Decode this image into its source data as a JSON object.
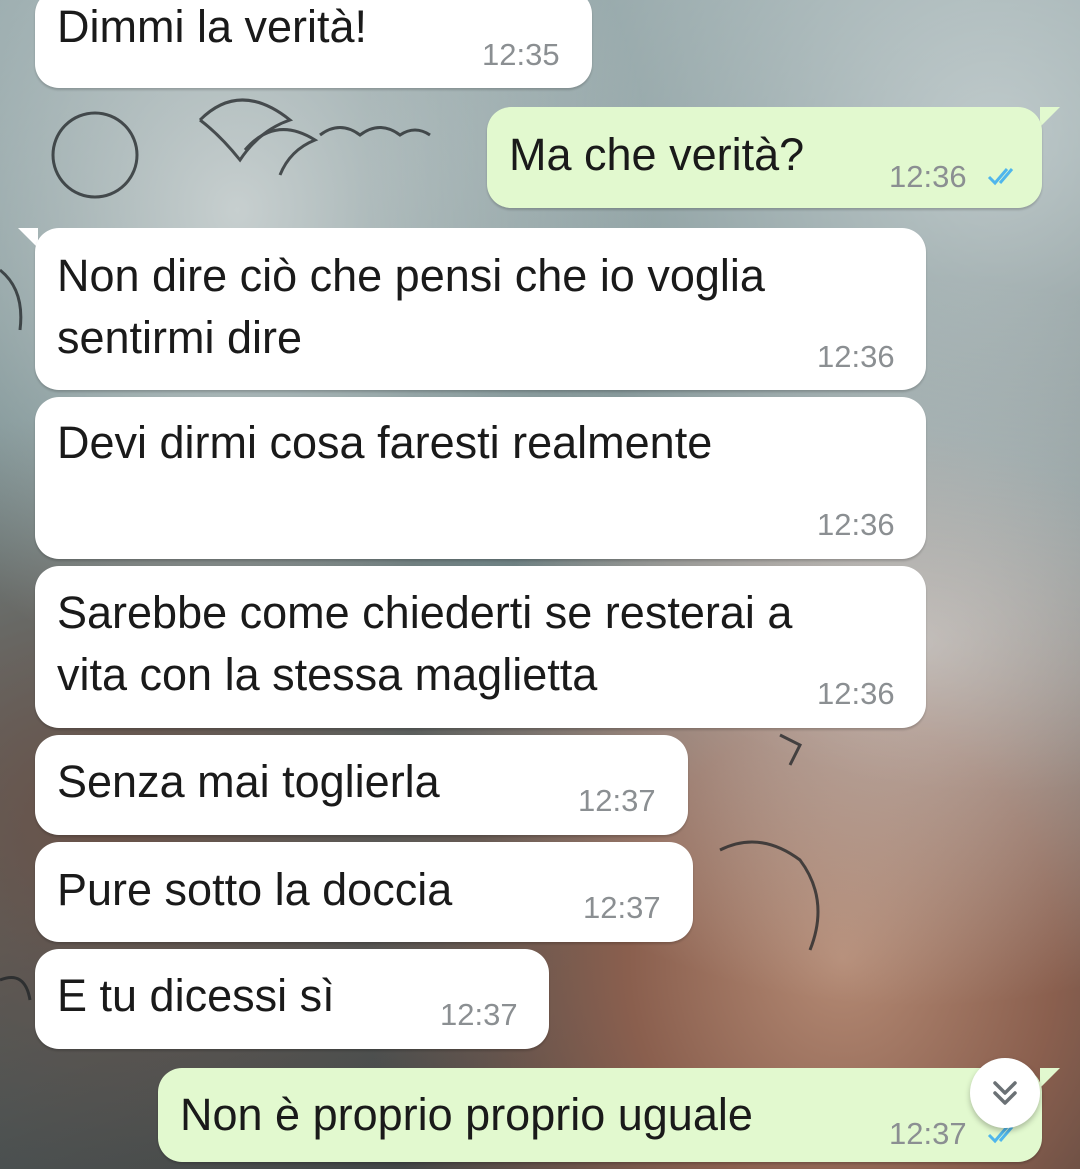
{
  "messages": [
    {
      "direction": "incoming",
      "text": "Dimmi la verità!",
      "time": "12:35"
    },
    {
      "direction": "outgoing",
      "text": "Ma che verità?",
      "time": "12:36",
      "status": "read"
    },
    {
      "direction": "incoming",
      "lines": [
        "Non dire ciò che pensi che io voglia",
        "sentirmi dire"
      ],
      "time": "12:36"
    },
    {
      "direction": "incoming",
      "text": "Devi dirmi cosa faresti realmente",
      "time": "12:36"
    },
    {
      "direction": "incoming",
      "lines": [
        "Sarebbe come chiederti se resterai a",
        "vita con la stessa maglietta"
      ],
      "time": "12:36"
    },
    {
      "direction": "incoming",
      "text": "Senza mai toglierla",
      "time": "12:37"
    },
    {
      "direction": "incoming",
      "text": "Pure sotto la doccia",
      "time": "12:37"
    },
    {
      "direction": "incoming",
      "text": "E tu dicessi sì",
      "time": "12:37"
    },
    {
      "direction": "outgoing",
      "text": "Non è proprio proprio uguale",
      "time": "12:37",
      "status": "read"
    }
  ],
  "colors": {
    "incoming_bubble": "#ffffff",
    "outgoing_bubble": "#e2f9cf",
    "read_ticks": "#4fb6ec",
    "timestamp": "#8b8f92"
  },
  "icons": {
    "read_receipt": "double-check-icon",
    "scroll_down": "double-chevron-down-icon"
  }
}
